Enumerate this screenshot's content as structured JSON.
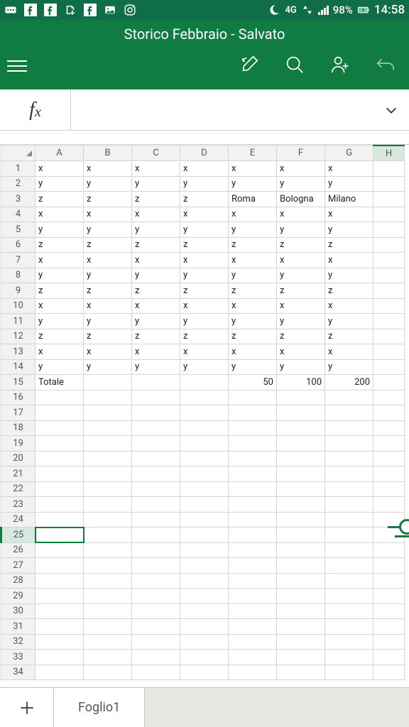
{
  "status": {
    "network": "4G",
    "battery": "98%",
    "time": "14:58"
  },
  "header": {
    "title": "Storico Febbraio - Salvato"
  },
  "formula": {
    "fx": "fx",
    "value": ""
  },
  "columns": [
    "A",
    "B",
    "C",
    "D",
    "E",
    "F",
    "G",
    "H"
  ],
  "rows_visible": 34,
  "selected_row": 25,
  "cells": {
    "1": {
      "A": "x",
      "B": "x",
      "C": "x",
      "D": "x",
      "E": "x",
      "F": "x",
      "G": "x"
    },
    "2": {
      "A": "y",
      "B": "y",
      "C": "y",
      "D": "y",
      "E": "y",
      "F": "y",
      "G": "y"
    },
    "3": {
      "A": "z",
      "B": "z",
      "C": "z",
      "D": "z",
      "E": "Roma",
      "F": "Bologna",
      "G": "Milano"
    },
    "4": {
      "A": "x",
      "B": "x",
      "C": "x",
      "D": "x",
      "E": "x",
      "F": "x",
      "G": "x"
    },
    "5": {
      "A": "y",
      "B": "y",
      "C": "y",
      "D": "y",
      "E": "y",
      "F": "y",
      "G": "y"
    },
    "6": {
      "A": "z",
      "B": "z",
      "C": "z",
      "D": "z",
      "E": "z",
      "F": "z",
      "G": "z"
    },
    "7": {
      "A": "x",
      "B": "x",
      "C": "x",
      "D": "x",
      "E": "x",
      "F": "x",
      "G": "x"
    },
    "8": {
      "A": "y",
      "B": "y",
      "C": "y",
      "D": "y",
      "E": "y",
      "F": "y",
      "G": "y"
    },
    "9": {
      "A": "z",
      "B": "z",
      "C": "z",
      "D": "z",
      "E": "z",
      "F": "z",
      "G": "z"
    },
    "10": {
      "A": "x",
      "B": "x",
      "C": "x",
      "D": "x",
      "E": "x",
      "F": "x",
      "G": "x"
    },
    "11": {
      "A": "y",
      "B": "y",
      "C": "y",
      "D": "y",
      "E": "y",
      "F": "y",
      "G": "y"
    },
    "12": {
      "A": "z",
      "B": "z",
      "C": "z",
      "D": "z",
      "E": "z",
      "F": "z",
      "G": "z"
    },
    "13": {
      "A": "x",
      "B": "x",
      "C": "x",
      "D": "x",
      "E": "x",
      "F": "x",
      "G": "x"
    },
    "14": {
      "A": "y",
      "B": "y",
      "C": "y",
      "D": "y",
      "E": "y",
      "F": "y",
      "G": "y"
    },
    "15": {
      "A": "Totale",
      "E": "50",
      "F": "100",
      "G": "200"
    }
  },
  "numeric_cols_row15": [
    "E",
    "F",
    "G"
  ],
  "sheet_tab": "Foglio1"
}
